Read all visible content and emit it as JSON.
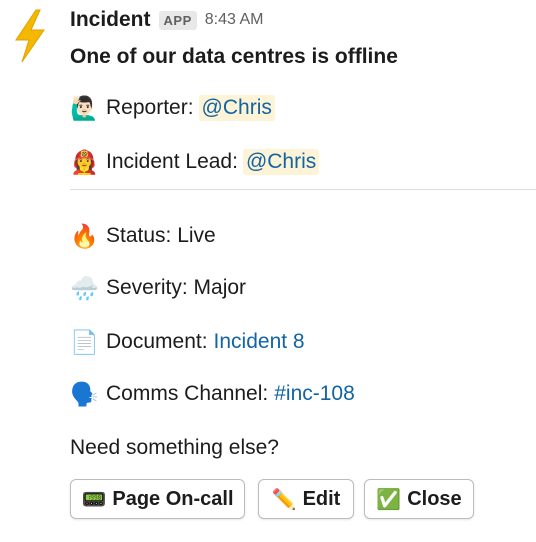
{
  "message": {
    "sender": "Incident",
    "badge": "APP",
    "time": "8:43 AM",
    "title": "One of our data centres is offline"
  },
  "fields": {
    "reporter": {
      "label": "Reporter:",
      "value": "@Chris",
      "icon": "hand-raised-person-emoji"
    },
    "incident_lead": {
      "label": "Incident Lead:",
      "value": "@Chris",
      "icon": "firefighter-emoji"
    },
    "status": {
      "label": "Status: Live",
      "icon": "fire-emoji"
    },
    "severity": {
      "label": "Severity: Major",
      "icon": "rain-cloud-emoji"
    },
    "document": {
      "label": "Document:",
      "value": "Incident 8",
      "icon": "page-emoji"
    },
    "comms_channel": {
      "label": "Comms Channel:",
      "value": "#inc-108",
      "icon": "speaking-head-emoji"
    }
  },
  "prompt": "Need something else?",
  "buttons": {
    "page_oncall": {
      "label": "Page On-call",
      "icon": "pager-emoji"
    },
    "edit": {
      "label": "Edit",
      "icon": "pencil-emoji"
    },
    "close": {
      "label": "Close",
      "icon": "check-mark-emoji"
    }
  },
  "colors": {
    "link": "#1264a3",
    "mention_bg": "#fdf3d7",
    "lightning": "#f5b800"
  }
}
